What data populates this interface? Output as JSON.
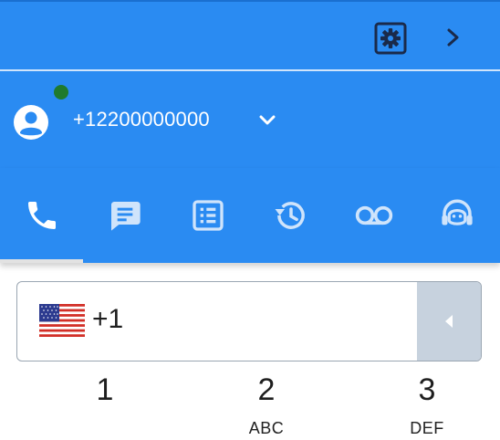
{
  "header": {
    "settings_icon": "settings-gear-icon",
    "expand_icon": "chevron-right-icon"
  },
  "account": {
    "phone_number": "+12200000000",
    "status": "online",
    "status_color": "#1f7a2e"
  },
  "tabs": [
    {
      "name": "dialpad",
      "icon": "phone-icon",
      "active": true
    },
    {
      "name": "messages",
      "icon": "message-icon",
      "active": false
    },
    {
      "name": "contacts",
      "icon": "contacts-list-icon",
      "active": false
    },
    {
      "name": "history",
      "icon": "history-icon",
      "active": false
    },
    {
      "name": "voicemail",
      "icon": "voicemail-icon",
      "active": false
    },
    {
      "name": "support",
      "icon": "headset-icon",
      "active": false
    }
  ],
  "dialer": {
    "country_code": "+1",
    "country_flag": "us-flag-icon"
  },
  "keypad": [
    {
      "digit": "1",
      "letters": ""
    },
    {
      "digit": "2",
      "letters": "ABC"
    },
    {
      "digit": "3",
      "letters": "DEF"
    }
  ],
  "colors": {
    "primary": "#2a8bf2",
    "backspace_bg": "#c7d2de"
  }
}
